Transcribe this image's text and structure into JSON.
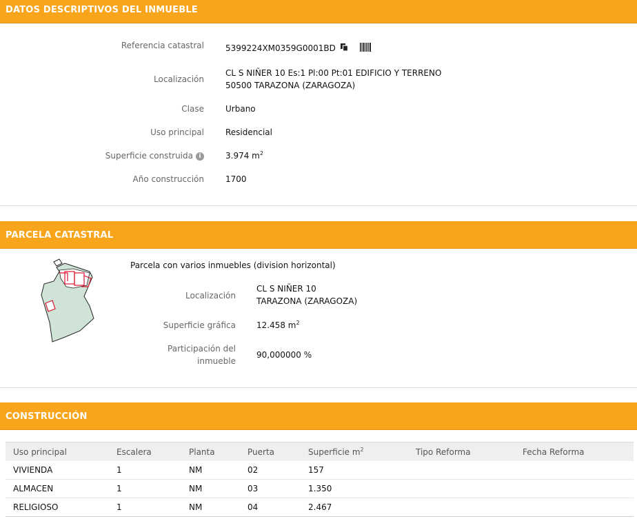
{
  "datos": {
    "section_title": "DATOS DESCRIPTIVOS DEL INMUEBLE",
    "ref_label": "Referencia catastral",
    "ref_value": "5399224XM0359G0001BD",
    "loc_label": "Localización",
    "loc_line1": "CL S NIÑER 10 Es:1 Pl:00 Pt:01 EDIFICIO Y TERRENO",
    "loc_line2": "50500 TARAZONA (ZARAGOZA)",
    "clase_label": "Clase",
    "clase_value": "Urbano",
    "uso_label": "Uso principal",
    "uso_value": "Residencial",
    "sup_label": "Superficie construida",
    "sup_value": "3.974 m",
    "sup_unit_sup": "2",
    "anio_label": "Año construcción",
    "anio_value": "1700"
  },
  "parcela": {
    "section_title": "PARCELA CATASTRAL",
    "header": "Parcela con varios inmuebles (division horizontal)",
    "loc_label": "Localización",
    "loc_line1": "CL S NIÑER 10",
    "loc_line2": "TARAZONA (ZARAGOZA)",
    "sup_label": "Superficie gráfica",
    "sup_value": "12.458 m",
    "sup_unit_sup": "2",
    "part_label_line1": "Participación del",
    "part_label_line2": "inmueble",
    "part_value": "90,000000 %"
  },
  "construccion": {
    "section_title": "CONSTRUCCIÓN",
    "columns": [
      "Uso principal",
      "Escalera",
      "Planta",
      "Puerta",
      "Superficie m",
      "Tipo Reforma",
      "Fecha Reforma"
    ],
    "sup_col_sup": "2",
    "rows": [
      [
        "VIVIENDA",
        "1",
        "NM",
        "02",
        "157",
        "",
        ""
      ],
      [
        "ALMACEN",
        "1",
        "NM",
        "03",
        "1.350",
        "",
        ""
      ],
      [
        "RELIGIOSO",
        "1",
        "NM",
        "04",
        "2.467",
        "",
        ""
      ]
    ]
  },
  "icons": {
    "copy": "copy-icon",
    "barcode": "barcode-icon",
    "info": "info-icon"
  },
  "colors": {
    "section_bar": "#f8a51b",
    "parcel_fill": "#cfe3d6",
    "parcel_subplot": "#d9152d"
  }
}
